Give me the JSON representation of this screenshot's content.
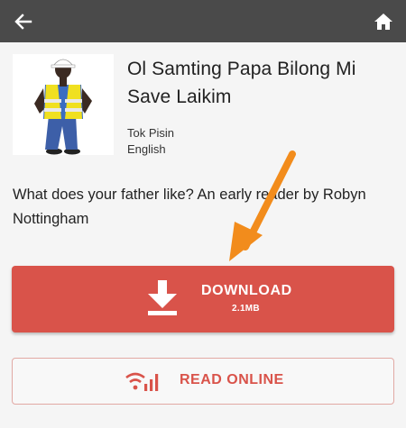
{
  "topbar": {
    "back_icon": "arrow-left-icon",
    "home_icon": "home-icon"
  },
  "book": {
    "title": "Ol Samting Papa Bilong Mi Save Laikim",
    "languages": [
      "Tok Pisin",
      "English"
    ],
    "description": "What does your father like? An early reader by Robyn Nottingham"
  },
  "download": {
    "label": "DOWNLOAD",
    "size": "2.1MB",
    "icon": "download-icon",
    "color": "#d9534a"
  },
  "read_online": {
    "label": "READ ONLINE",
    "icon": "signal-icon",
    "color": "#d9534a"
  },
  "annotation": {
    "icon": "pointer-arrow-icon",
    "color": "#f28c1c"
  }
}
